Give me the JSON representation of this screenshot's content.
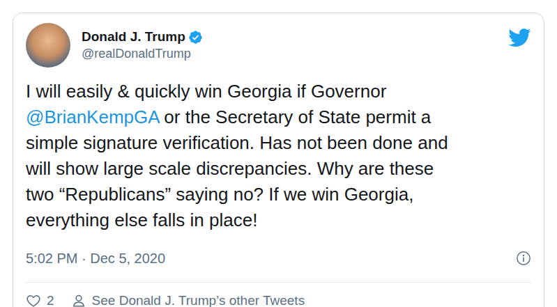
{
  "tweet": {
    "author": {
      "name": "Donald J. Trump",
      "verified": true,
      "handle": "@realDonaldTrump"
    },
    "lines": [
      [
        {
          "kind": "text",
          "text": "I will easily & quickly win Georgia if Governor"
        }
      ],
      [
        {
          "kind": "mention",
          "text": "@BrianKempGA"
        },
        {
          "kind": "text",
          "text": " or the Secretary of State permit a"
        }
      ],
      [
        {
          "kind": "text",
          "text": "simple signature verification. Has not been done and"
        }
      ],
      [
        {
          "kind": "text",
          "text": "will show large scale discrepancies. Why are these"
        }
      ],
      [
        {
          "kind": "text",
          "text": "two “Republicans” saying no? If we win Georgia,"
        }
      ],
      [
        {
          "kind": "text",
          "text": "everything else falls in place!"
        }
      ]
    ],
    "timestamp": "5:02 PM · Dec 5, 2020",
    "likes": "2",
    "profile_link": "See Donald J. Trump’s other Tweets"
  }
}
